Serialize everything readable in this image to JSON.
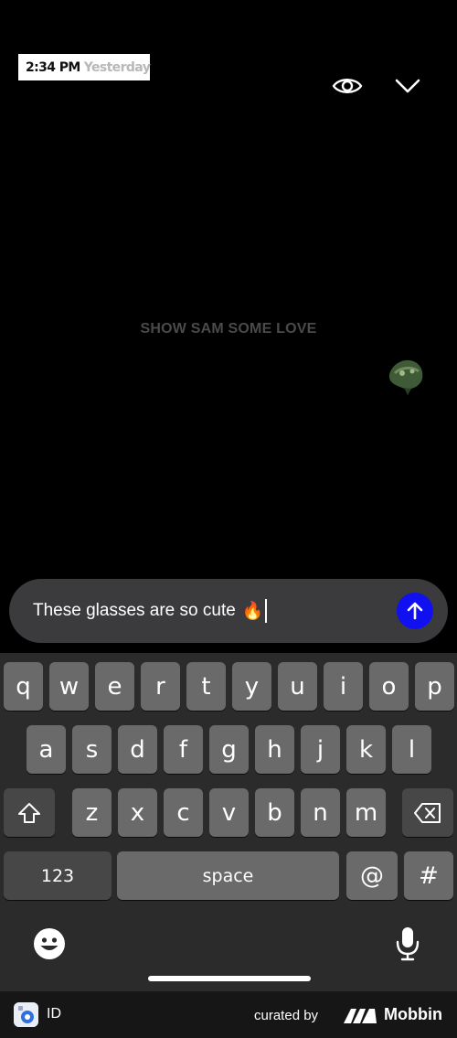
{
  "story": {
    "time": "2:34 PM",
    "day": "Yesterday",
    "prompt": "SHOW SAM SOME LOVE",
    "icons": [
      "eye-icon",
      "chevron-down-icon",
      "frog-sticker"
    ]
  },
  "composer": {
    "text": "These glasses are so cute",
    "emoji": "🔥",
    "send_icon": "arrow-up-icon",
    "send_color": "#1010f0"
  },
  "keyboard": {
    "row1": [
      "q",
      "w",
      "e",
      "r",
      "t",
      "y",
      "u",
      "i",
      "o",
      "p"
    ],
    "row2": [
      "a",
      "s",
      "d",
      "f",
      "g",
      "h",
      "j",
      "k",
      "l"
    ],
    "row3": [
      "z",
      "x",
      "c",
      "v",
      "b",
      "n",
      "m"
    ],
    "numbers_label": "123",
    "space_label": "space",
    "at_label": "@",
    "hash_label": "#",
    "icons": [
      "shift-icon",
      "backspace-icon",
      "emoji-icon",
      "microphone-icon"
    ]
  },
  "footer": {
    "id_label": "ID",
    "curated_label": "curated by",
    "brand": "Mobbin"
  }
}
